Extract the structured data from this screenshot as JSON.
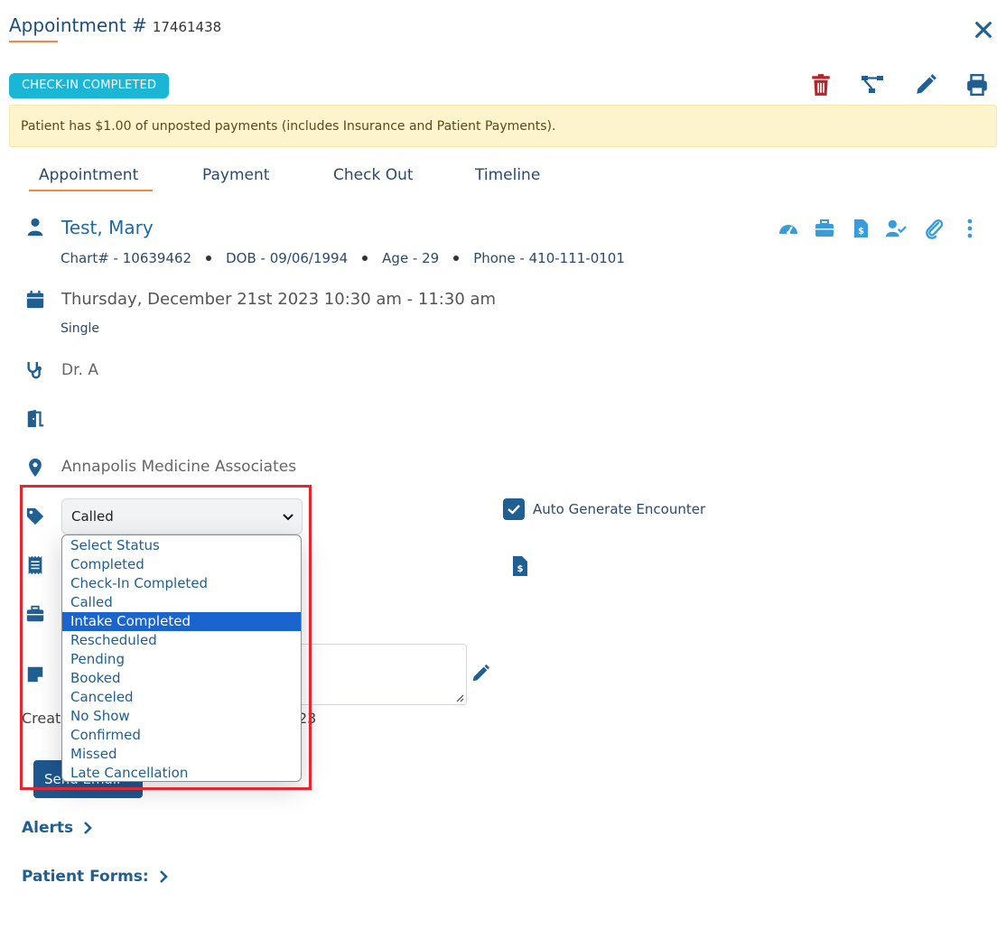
{
  "header": {
    "title": "Appointment #",
    "number": "17461438",
    "status_badge": "CHECK-IN COMPLETED"
  },
  "alert": {
    "text": "Patient has $1.00 of unposted payments (includes Insurance and Patient Payments)."
  },
  "tabs": [
    {
      "label": "Appointment",
      "active": true
    },
    {
      "label": "Payment"
    },
    {
      "label": "Check Out"
    },
    {
      "label": "Timeline"
    }
  ],
  "patient": {
    "name": "Test, Mary",
    "chart": "Chart# - 10639462",
    "dob": "DOB - 09/06/1994",
    "age": "Age - 29",
    "phone": "Phone - 410-111-0101"
  },
  "appointment": {
    "datetime": "Thursday, December 21st 2023 10:30 am - 11:30 am",
    "type": "Single",
    "provider": "Dr. A",
    "location": "Annapolis Medicine Associates"
  },
  "status_select": {
    "value": "Called",
    "options": [
      "Select Status",
      "Completed",
      "Check-In Completed",
      "Called",
      "Intake Completed",
      "Rescheduled",
      "Pending",
      "Booked",
      "Canceled",
      "No Show",
      "Confirmed",
      "Missed",
      "Late Cancellation"
    ],
    "highlighted_index": 4
  },
  "auto_generate": {
    "label": "Auto Generate Encounter",
    "checked": true
  },
  "created": {
    "prefix": "Creat",
    "suffix": "23"
  },
  "send_email_label": "Send Email",
  "links": {
    "alerts": "Alerts",
    "patient_forms": "Patient Forms:"
  },
  "colors": {
    "primary": "#1f5f91",
    "accent": "#f0883e",
    "badge": "#19b6d6",
    "danger": "#b3262b",
    "alert_bg": "#fdf3cd",
    "highlight": "#e3262f"
  }
}
